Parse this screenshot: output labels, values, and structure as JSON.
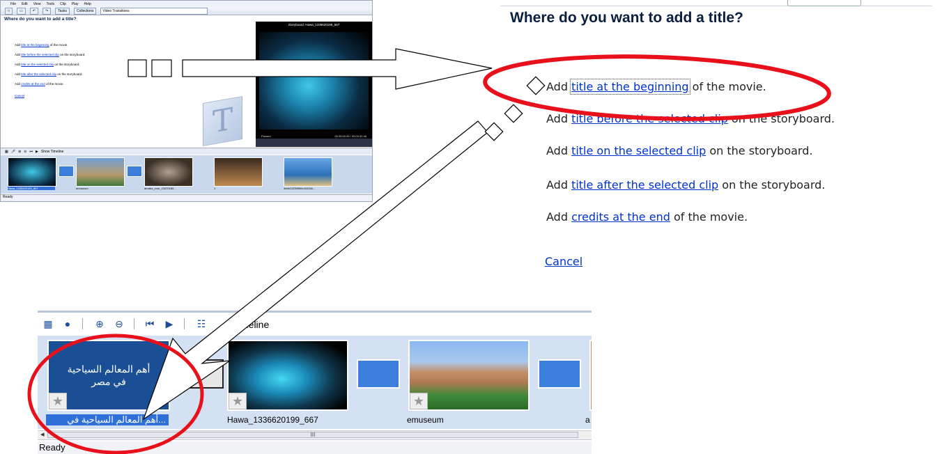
{
  "thumbnail": {
    "menu": [
      "File",
      "Edit",
      "View",
      "Tools",
      "Clip",
      "Play",
      "Help"
    ],
    "toolbar": {
      "tasks_label": "Tasks",
      "collections_label": "Collections",
      "select_value": "Video Transitions"
    },
    "heading": "Where do you want to add a title?",
    "player_title": "Storyboard: Hawa_1336620199_667",
    "player_status": "Paused",
    "player_time": "00:00:00.00 / 00:00:32.48",
    "show_timeline_label": "Show Timeline",
    "clips": [
      {
        "label": "Hawa_1336620199_667"
      },
      {
        "label": "emuseum"
      },
      {
        "label": "ahraba_com_13470180..."
      },
      {
        "label": "1"
      },
      {
        "label": "3ebb1123f9f50e41516b..."
      }
    ],
    "status": "Ready"
  },
  "dialog": {
    "heading": "Where do you want to add a title?",
    "options": [
      {
        "prefix": "Add ",
        "link": "title at the beginning",
        "suffix": " of the movie."
      },
      {
        "prefix": "Add ",
        "link": "title before the selected clip",
        "suffix": " on the storyboard."
      },
      {
        "prefix": "Add ",
        "link": "title on the selected clip",
        "suffix": " on the storyboard."
      },
      {
        "prefix": "Add ",
        "link": "title after the selected clip",
        "suffix": " on the storyboard."
      },
      {
        "prefix": "Add ",
        "link": "credits at the end",
        "suffix": " of the movie."
      }
    ],
    "cancel": "Cancel"
  },
  "storyboard": {
    "toolbar_label": "meline",
    "title_clip_text": "أهم المعالم السياحية في مصر",
    "title_clip_label": "...أهم المعالم السياحية في",
    "clip_labels": [
      "Hawa_1336620199_667",
      "emuseum",
      "a"
    ],
    "scroll_grip": "III",
    "status": "Ready"
  },
  "colors": {
    "accent": "#e8101a",
    "link": "#0033cc",
    "selection": "#2e6fd8",
    "title_clip": "#1a4f96"
  }
}
